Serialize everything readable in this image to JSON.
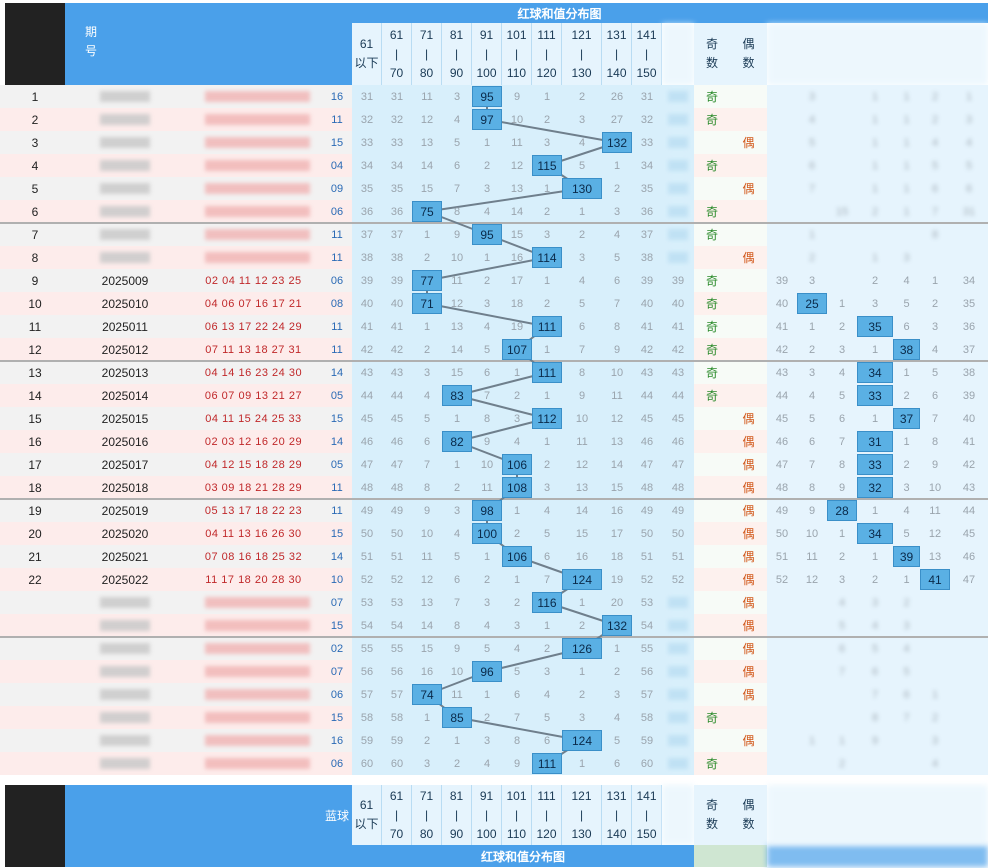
{
  "header": {
    "period_label_1": "期",
    "period_label_2": "号",
    "chart_title": "红球和值分布图",
    "blue_label": "蓝球",
    "odd_label_1": "奇",
    "odd_label_2": "数",
    "even_label_1": "偶",
    "even_label_2": "数",
    "ranges": [
      {
        "top": "61",
        "mid": "以下",
        "bot": ""
      },
      {
        "top": "61",
        "mid": "|",
        "bot": "70"
      },
      {
        "top": "71",
        "mid": "|",
        "bot": "80"
      },
      {
        "top": "81",
        "mid": "|",
        "bot": "90"
      },
      {
        "top": "91",
        "mid": "|",
        "bot": "100"
      },
      {
        "top": "101",
        "mid": "|",
        "bot": "110"
      },
      {
        "top": "111",
        "mid": "|",
        "bot": "120"
      },
      {
        "top": "121",
        "mid": "|",
        "bot": "130"
      },
      {
        "top": "131",
        "mid": "|",
        "bot": "140"
      },
      {
        "top": "141",
        "mid": "|",
        "bot": "150"
      }
    ]
  },
  "chart_data": {
    "type": "table",
    "title": "红球和值分布图",
    "columns": [
      "61以下",
      "61-70",
      "71-80",
      "81-90",
      "91-100",
      "101-110",
      "111-120",
      "121-130",
      "131-140",
      "141-150"
    ],
    "rows": [
      {
        "idx": "1",
        "issue": "",
        "nums": "",
        "blue": "16",
        "sum": 95,
        "misses": [
          "31",
          "31",
          "11",
          "3",
          "",
          "9",
          "1",
          "2",
          "26",
          "31"
        ],
        "parity": "odd",
        "right": [
          "",
          "3",
          "",
          "1",
          "1",
          "2",
          "1"
        ]
      },
      {
        "idx": "2",
        "issue": "",
        "nums": "",
        "blue": "11",
        "sum": 97,
        "misses": [
          "32",
          "32",
          "12",
          "4",
          "",
          "10",
          "2",
          "3",
          "27",
          "32"
        ],
        "parity": "odd",
        "right": [
          "",
          "4",
          "",
          "1",
          "1",
          "2",
          "3"
        ]
      },
      {
        "idx": "3",
        "issue": "",
        "nums": "",
        "blue": "15",
        "sum": 132,
        "misses": [
          "33",
          "33",
          "13",
          "5",
          "1",
          "11",
          "3",
          "4",
          "",
          "33"
        ],
        "parity": "even",
        "right": [
          "",
          "5",
          "",
          "1",
          "1",
          "4",
          "4"
        ]
      },
      {
        "idx": "4",
        "issue": "",
        "nums": "",
        "blue": "04",
        "sum": 115,
        "misses": [
          "34",
          "34",
          "14",
          "6",
          "2",
          "12",
          "",
          "5",
          "1",
          "34"
        ],
        "parity": "odd",
        "right": [
          "",
          "6",
          "",
          "1",
          "1",
          "5",
          "5"
        ]
      },
      {
        "idx": "5",
        "issue": "",
        "nums": "",
        "blue": "09",
        "sum": 130,
        "misses": [
          "35",
          "35",
          "15",
          "7",
          "3",
          "13",
          "1",
          "",
          "2",
          "35"
        ],
        "parity": "even",
        "right": [
          "",
          "7",
          "",
          "1",
          "1",
          "6",
          "6"
        ]
      },
      {
        "idx": "6",
        "issue": "",
        "nums": "",
        "blue": "06",
        "sum": 75,
        "misses": [
          "36",
          "36",
          "",
          "8",
          "4",
          "14",
          "2",
          "1",
          "3",
          "36"
        ],
        "parity": "odd",
        "right": [
          "",
          "",
          "15",
          "2",
          "1",
          "7",
          "31"
        ]
      },
      {
        "idx": "7",
        "issue": "",
        "nums": "",
        "blue": "11",
        "sum": 95,
        "misses": [
          "37",
          "37",
          "1",
          "9",
          "",
          "15",
          "3",
          "2",
          "4",
          "37"
        ],
        "parity": "odd",
        "right": [
          "",
          "1",
          "",
          "",
          "",
          "8",
          ""
        ]
      },
      {
        "idx": "8",
        "issue": "",
        "nums": "",
        "blue": "11",
        "sum": 114,
        "misses": [
          "38",
          "38",
          "2",
          "10",
          "1",
          "16",
          "",
          "3",
          "5",
          "38"
        ],
        "parity": "even",
        "right": [
          "",
          "2",
          "",
          "1",
          "3",
          "",
          ""
        ]
      },
      {
        "idx": "9",
        "issue": "2025009",
        "nums": "02 04 11 12 23 25",
        "blue": "06",
        "sum": 77,
        "misses": [
          "39",
          "39",
          "",
          "11",
          "2",
          "17",
          "1",
          "4",
          "6",
          "39"
        ],
        "extra": "39",
        "parity": "odd",
        "right": [
          "39",
          "3",
          "",
          "2",
          "4",
          "1",
          "34"
        ]
      },
      {
        "idx": "10",
        "issue": "2025010",
        "nums": "04 06 07 16 17 21",
        "blue": "08",
        "sum": 71,
        "misses": [
          "40",
          "40",
          "",
          "12",
          "3",
          "18",
          "2",
          "5",
          "7",
          "40"
        ],
        "extra": "40",
        "parity": "odd",
        "right": [
          "40",
          "25",
          "1",
          "3",
          "5",
          "2",
          "35"
        ]
      },
      {
        "idx": "11",
        "issue": "2025011",
        "nums": "06 13 17 22 24 29",
        "blue": "11",
        "sum": 111,
        "misses": [
          "41",
          "41",
          "1",
          "13",
          "4",
          "19",
          "",
          "6",
          "8",
          "41"
        ],
        "extra": "41",
        "parity": "odd",
        "right": [
          "41",
          "1",
          "2",
          "35",
          "6",
          "3",
          "36"
        ]
      },
      {
        "idx": "12",
        "issue": "2025012",
        "nums": "07 11 13 18 27 31",
        "blue": "11",
        "sum": 107,
        "misses": [
          "42",
          "42",
          "2",
          "14",
          "5",
          "",
          "1",
          "7",
          "9",
          "42"
        ],
        "extra": "42",
        "parity": "odd",
        "right": [
          "42",
          "2",
          "3",
          "1",
          "38",
          "4",
          "37"
        ]
      },
      {
        "idx": "13",
        "issue": "2025013",
        "nums": "04 14 16 23 24 30",
        "blue": "14",
        "sum": 111,
        "misses": [
          "43",
          "43",
          "3",
          "15",
          "6",
          "1",
          "",
          "8",
          "10",
          "43"
        ],
        "extra": "43",
        "parity": "odd",
        "right": [
          "43",
          "3",
          "4",
          "34",
          "1",
          "5",
          "38"
        ]
      },
      {
        "idx": "14",
        "issue": "2025014",
        "nums": "06 07 09 13 21 27",
        "blue": "05",
        "sum": 83,
        "misses": [
          "44",
          "44",
          "4",
          "",
          "7",
          "2",
          "1",
          "9",
          "11",
          "44"
        ],
        "extra": "44",
        "parity": "odd",
        "right": [
          "44",
          "4",
          "5",
          "33",
          "2",
          "6",
          "39"
        ]
      },
      {
        "idx": "15",
        "issue": "2025015",
        "nums": "04 11 15 24 25 33",
        "blue": "15",
        "sum": 112,
        "misses": [
          "45",
          "45",
          "5",
          "1",
          "8",
          "3",
          "",
          "10",
          "12",
          "45"
        ],
        "extra": "45",
        "parity": "even",
        "right": [
          "45",
          "5",
          "6",
          "1",
          "37",
          "7",
          "40"
        ]
      },
      {
        "idx": "16",
        "issue": "2025016",
        "nums": "02 03 12 16 20 29",
        "blue": "14",
        "sum": 82,
        "misses": [
          "46",
          "46",
          "6",
          "",
          "9",
          "4",
          "1",
          "11",
          "13",
          "46"
        ],
        "extra": "46",
        "parity": "even",
        "right": [
          "46",
          "6",
          "7",
          "31",
          "1",
          "8",
          "41"
        ]
      },
      {
        "idx": "17",
        "issue": "2025017",
        "nums": "04 12 15 18 28 29",
        "blue": "05",
        "sum": 106,
        "misses": [
          "47",
          "47",
          "7",
          "1",
          "10",
          "",
          "2",
          "12",
          "14",
          "47"
        ],
        "extra": "47",
        "parity": "even",
        "right": [
          "47",
          "7",
          "8",
          "33",
          "2",
          "9",
          "42"
        ]
      },
      {
        "idx": "18",
        "issue": "2025018",
        "nums": "03 09 18 21 28 29",
        "blue": "11",
        "sum": 108,
        "misses": [
          "48",
          "48",
          "8",
          "2",
          "11",
          "",
          "3",
          "13",
          "15",
          "48"
        ],
        "extra": "48",
        "parity": "even",
        "right": [
          "48",
          "8",
          "9",
          "32",
          "3",
          "10",
          "43"
        ]
      },
      {
        "idx": "19",
        "issue": "2025019",
        "nums": "05 13 17 18 22 23",
        "blue": "11",
        "sum": 98,
        "misses": [
          "49",
          "49",
          "9",
          "3",
          "",
          "1",
          "4",
          "14",
          "16",
          "49"
        ],
        "extra": "49",
        "parity": "even",
        "right": [
          "49",
          "9",
          "28",
          "1",
          "4",
          "11",
          "44"
        ]
      },
      {
        "idx": "20",
        "issue": "2025020",
        "nums": "04 11 13 16 26 30",
        "blue": "15",
        "sum": 100,
        "misses": [
          "50",
          "50",
          "10",
          "4",
          "",
          "2",
          "5",
          "15",
          "17",
          "50"
        ],
        "extra": "50",
        "parity": "even",
        "right": [
          "50",
          "10",
          "1",
          "34",
          "5",
          "12",
          "45"
        ]
      },
      {
        "idx": "21",
        "issue": "2025021",
        "nums": "07 08 16 18 25 32",
        "blue": "14",
        "sum": 106,
        "misses": [
          "51",
          "51",
          "11",
          "5",
          "1",
          "",
          "6",
          "16",
          "18",
          "51"
        ],
        "extra": "51",
        "parity": "even",
        "right": [
          "51",
          "11",
          "2",
          "1",
          "39",
          "13",
          "46"
        ]
      },
      {
        "idx": "22",
        "issue": "2025022",
        "nums": "11 17 18 20 28 30",
        "blue": "10",
        "sum": 124,
        "misses": [
          "52",
          "52",
          "12",
          "6",
          "2",
          "1",
          "7",
          "",
          "19",
          "52"
        ],
        "extra": "52",
        "parity": "even",
        "right": [
          "52",
          "12",
          "3",
          "2",
          "1",
          "41",
          "47"
        ]
      },
      {
        "idx": "",
        "issue": "",
        "nums": "",
        "blue": "07",
        "sum": 116,
        "misses": [
          "53",
          "53",
          "13",
          "7",
          "3",
          "2",
          "",
          "1",
          "20",
          "53"
        ],
        "parity": "even",
        "right": [
          "",
          "",
          "4",
          "3",
          "2",
          "",
          ""
        ]
      },
      {
        "idx": "",
        "issue": "",
        "nums": "",
        "blue": "15",
        "sum": 132,
        "misses": [
          "54",
          "54",
          "14",
          "8",
          "4",
          "3",
          "1",
          "2",
          "",
          "54"
        ],
        "parity": "even",
        "right": [
          "",
          "",
          "5",
          "4",
          "3",
          "",
          ""
        ]
      },
      {
        "idx": "",
        "issue": "",
        "nums": "",
        "blue": "02",
        "sum": 126,
        "misses": [
          "55",
          "55",
          "15",
          "9",
          "5",
          "4",
          "2",
          "",
          "1",
          "55"
        ],
        "parity": "even",
        "right": [
          "",
          "",
          "6",
          "5",
          "4",
          "",
          ""
        ]
      },
      {
        "idx": "",
        "issue": "",
        "nums": "",
        "blue": "07",
        "sum": 96,
        "misses": [
          "56",
          "56",
          "16",
          "10",
          "",
          "5",
          "3",
          "1",
          "2",
          "56"
        ],
        "parity": "even",
        "right": [
          "",
          "",
          "7",
          "6",
          "5",
          "",
          ""
        ]
      },
      {
        "idx": "",
        "issue": "",
        "nums": "",
        "blue": "06",
        "sum": 74,
        "misses": [
          "57",
          "57",
          "",
          "11",
          "1",
          "6",
          "4",
          "2",
          "3",
          "57"
        ],
        "parity": "even",
        "right": [
          "",
          "",
          "",
          "7",
          "6",
          "1",
          ""
        ]
      },
      {
        "idx": "",
        "issue": "",
        "nums": "",
        "blue": "15",
        "sum": 85,
        "misses": [
          "58",
          "58",
          "1",
          "",
          "2",
          "7",
          "5",
          "3",
          "4",
          "58"
        ],
        "parity": "odd",
        "right": [
          "",
          "",
          "",
          "8",
          "7",
          "2",
          ""
        ]
      },
      {
        "idx": "",
        "issue": "",
        "nums": "",
        "blue": "16",
        "sum": 124,
        "misses": [
          "59",
          "59",
          "2",
          "1",
          "3",
          "8",
          "6",
          "",
          "5",
          "59"
        ],
        "parity": "even",
        "right": [
          "",
          "1",
          "1",
          "9",
          "",
          "3",
          ""
        ]
      },
      {
        "idx": "",
        "issue": "",
        "nums": "",
        "blue": "06",
        "sum": 111,
        "misses": [
          "60",
          "60",
          "3",
          "2",
          "4",
          "9",
          "",
          "1",
          "6",
          "60"
        ],
        "parity": "odd",
        "right": [
          "",
          "",
          "2",
          "",
          "",
          "4",
          ""
        ]
      }
    ]
  },
  "colors": {
    "header_blue": "#4aa0ea",
    "cell_light_blue": "#d6eefb",
    "hit_blue": "#5ab0e4",
    "odd_green": "#2a8a2a",
    "even_orange": "#d2581a",
    "red_numbers": "#c0282a"
  }
}
